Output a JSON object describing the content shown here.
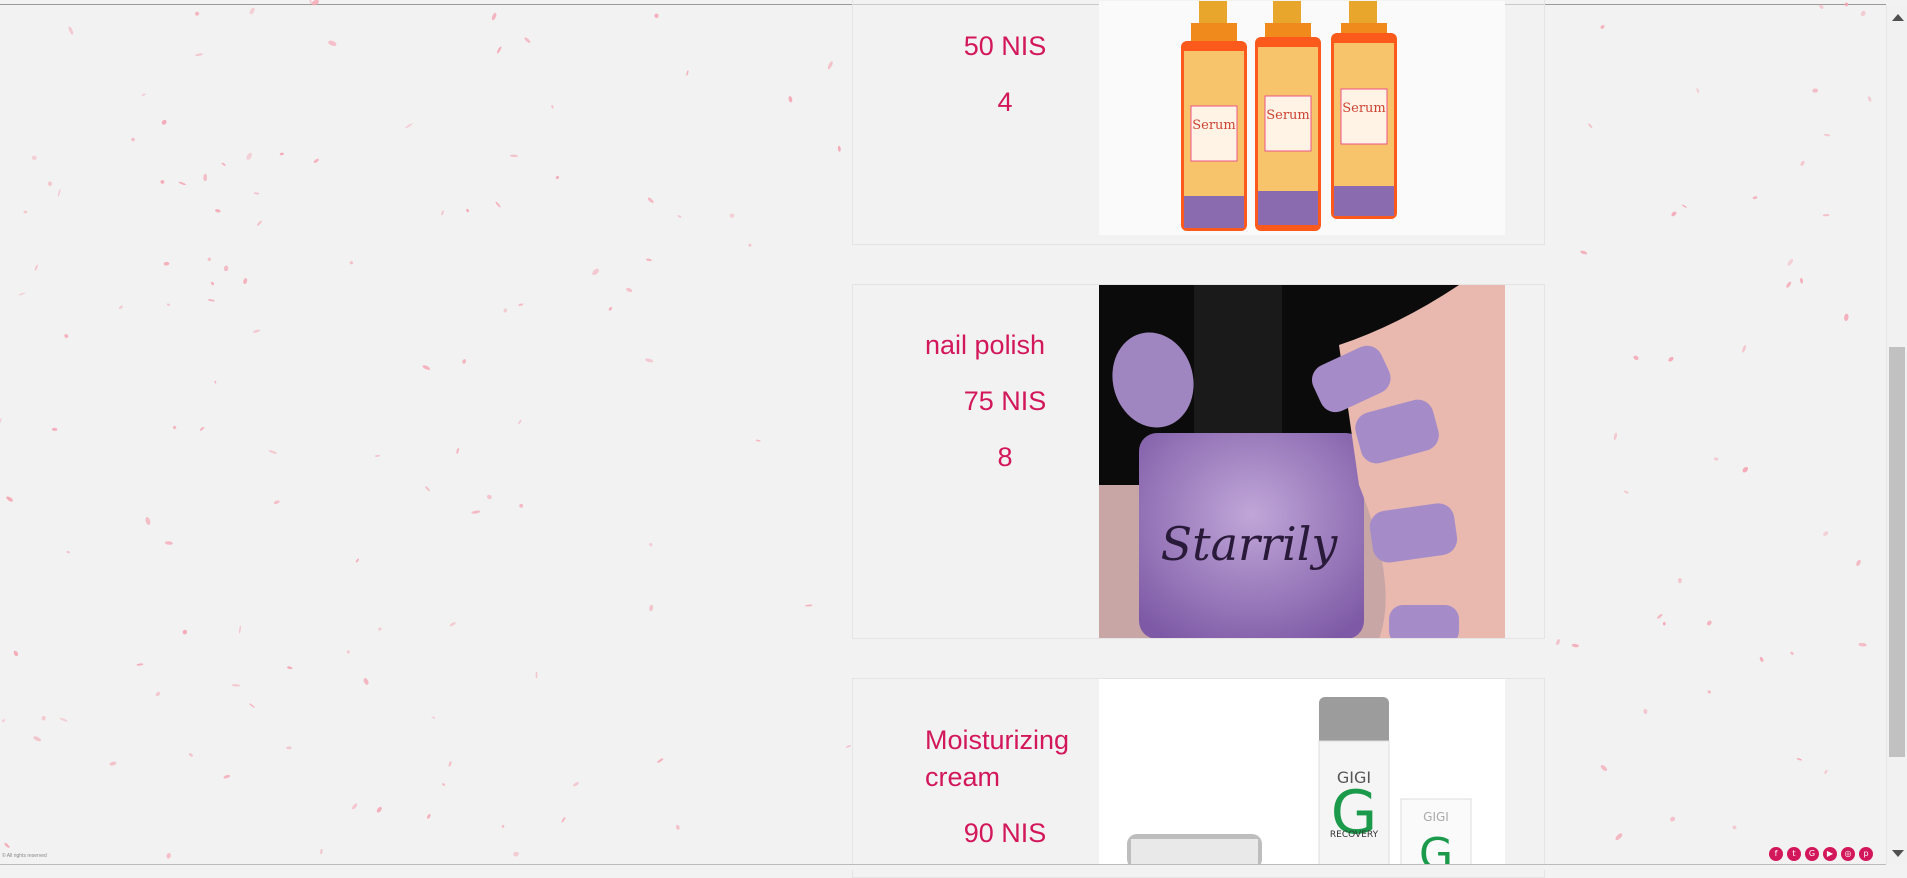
{
  "products": [
    {
      "name": "",
      "price": "50 NIS",
      "qty": "4",
      "image": "serum-bottles"
    },
    {
      "name": "nail polish",
      "price": "75 NIS",
      "qty": "8",
      "image": "glitter-nail-polish",
      "bottle_text": "Starrily"
    },
    {
      "name": "Moisturizing cream",
      "price": "90 NIS",
      "qty": "",
      "image": "gigi-recovery-cream",
      "brand_text": "GIGI",
      "line_text": "RECOVERY"
    }
  ],
  "serum_label": "Serum",
  "footer": {
    "copyright": "© All rights reserved"
  },
  "social_icons": [
    "facebook-icon",
    "twitter-icon",
    "google-plus-icon",
    "youtube-icon",
    "instagram-icon",
    "pinterest-icon"
  ],
  "social_glyphs": [
    "f",
    "t",
    "G",
    "▶",
    "◎",
    "p"
  ],
  "colors": {
    "accent": "#d2175a",
    "background": "#f2f2f2",
    "speckle": "#f4a6b4"
  }
}
